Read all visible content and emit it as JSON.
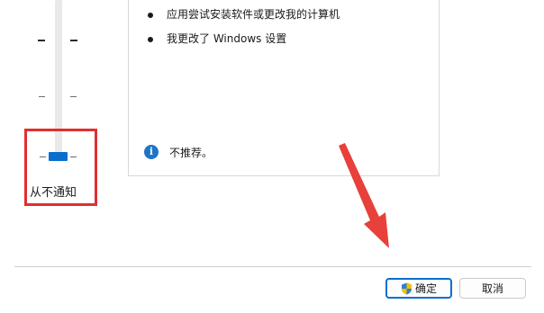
{
  "slider": {
    "level_label": "从不通知",
    "selected_level_index": 3,
    "levels_total": 4
  },
  "info_panel": {
    "bullets": [
      "应用尝试安装软件或更改我的计算机",
      "我更改了 Windows 设置"
    ],
    "recommendation_text": "不推荐。",
    "info_icon": "info-icon"
  },
  "buttons": {
    "ok_label": "确定",
    "ok_icon": "uac-shield-icon",
    "cancel_label": "取消"
  },
  "colors": {
    "accent": "#0b6ecf",
    "highlight": "#e02f2f",
    "arrow": "#e8403a"
  }
}
